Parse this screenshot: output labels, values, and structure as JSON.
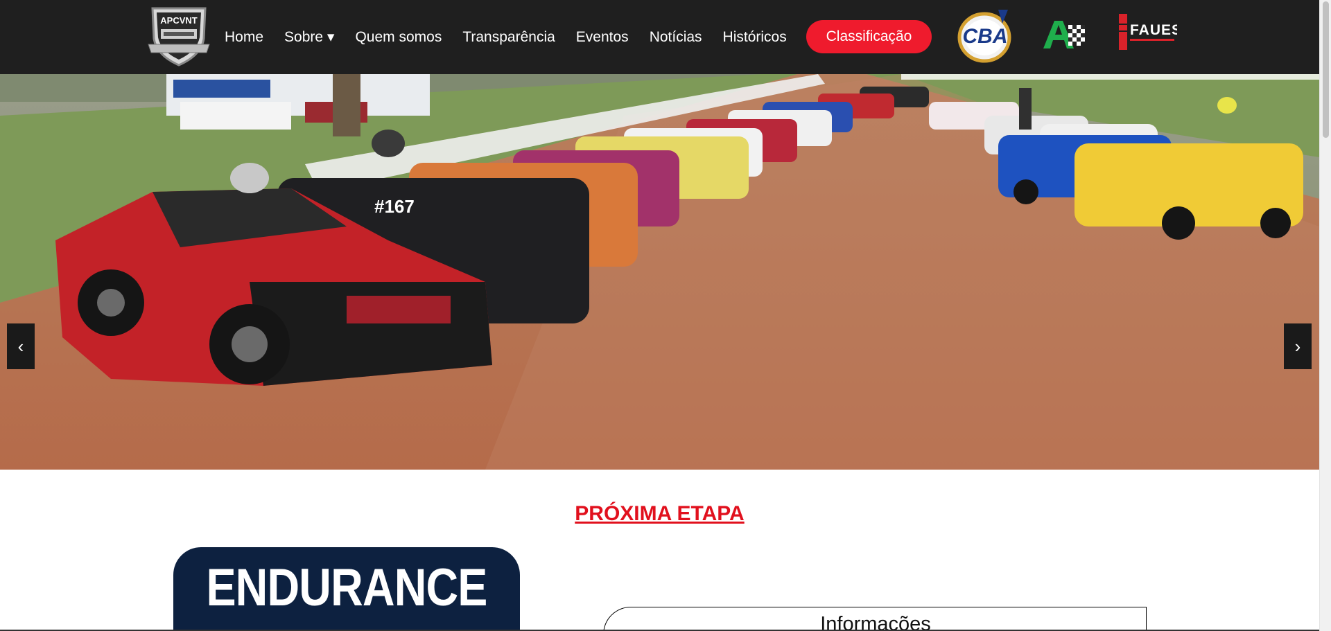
{
  "header": {
    "logo_text": "APCVNT",
    "nav": [
      {
        "label": "Home"
      },
      {
        "label": "Sobre ▾"
      },
      {
        "label": "Quem somos"
      },
      {
        "label": "Transparência"
      },
      {
        "label": "Eventos"
      },
      {
        "label": "Notícias"
      },
      {
        "label": "Históricos"
      }
    ],
    "cta_label": "Classificação",
    "partners": [
      "CBA",
      "FAUESC"
    ]
  },
  "hero": {
    "prev_label": "‹",
    "next_label": "›",
    "car_number": "#167"
  },
  "main": {
    "section_title": "PRÓXIMA ETAPA",
    "event_title": "ENDURANCE",
    "info_heading": "Informações"
  },
  "colors": {
    "navbar_bg": "#1f1f1f",
    "accent_red": "#ef1b2d",
    "title_red": "#e1101d",
    "card_navy": "#0d2140"
  }
}
